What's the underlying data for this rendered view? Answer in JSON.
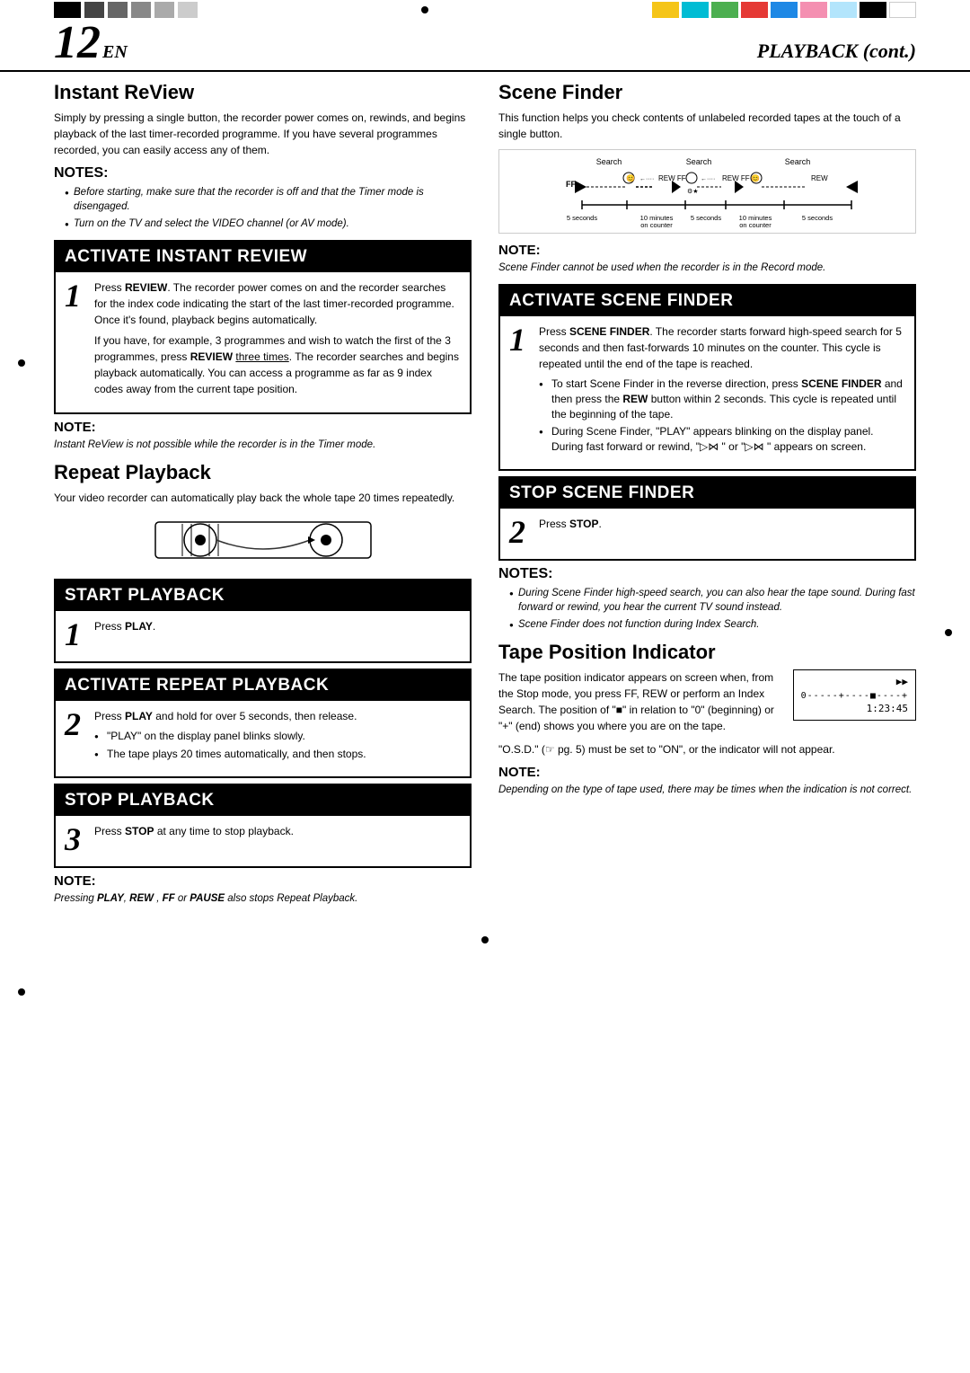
{
  "page": {
    "number": "12",
    "en": "EN",
    "title": "PLAYBACK (cont.)"
  },
  "colorbar_left": [
    {
      "color": "black",
      "label": "black-1"
    },
    {
      "color": "dark",
      "label": "dark-1"
    },
    {
      "color": "dark",
      "label": "dark-2"
    },
    {
      "color": "dark",
      "label": "dark-3"
    },
    {
      "color": "dark",
      "label": "dark-4"
    },
    {
      "color": "dark",
      "label": "dark-5"
    }
  ],
  "colorbar_right": [
    {
      "color": "yellow",
      "label": "yellow"
    },
    {
      "color": "cyan",
      "label": "cyan"
    },
    {
      "color": "green",
      "label": "green"
    },
    {
      "color": "red",
      "label": "red"
    },
    {
      "color": "blue",
      "label": "blue"
    },
    {
      "color": "pink",
      "label": "pink"
    },
    {
      "color": "lightblue",
      "label": "lightblue"
    },
    {
      "color": "black",
      "label": "black-2"
    },
    {
      "color": "white",
      "label": "white"
    }
  ],
  "instant_review": {
    "title": "Instant ReView",
    "description": "Simply by pressing a single button, the recorder power comes on, rewinds, and begins playback of the last timer-recorded programme. If you have several programmes recorded, you can easily access any of them.",
    "notes_header": "NOTES:",
    "notes": [
      "Before starting, make sure that the recorder is off and that the Timer mode is disengaged.",
      "Turn on the TV and select the VIDEO channel (or AV mode)."
    ],
    "step1_header": "ACTIVATE INSTANT REVIEW",
    "step1_body": "Press REVIEW. The recorder power comes on and the recorder searches for the index code indicating the start of the last timer-recorded programme. Once it's found, playback begins automatically.\nIf you have, for example, 3 programmes and wish to watch the first of the 3 programmes, press REVIEW three times. The recorder searches and begins playback automatically. You can access a programme as far as 9 index codes away from the current tape position.",
    "note_header": "NOTE:",
    "note_text": "Instant ReView is not possible while the recorder is in the Timer mode."
  },
  "repeat_playback": {
    "title": "Repeat Playback",
    "description": "Your video recorder can automatically play back the whole tape 20 times repeatedly.",
    "step1_header": "START PLAYBACK",
    "step1_body": "Press PLAY.",
    "step2_header": "ACTIVATE REPEAT PLAYBACK",
    "step2_body": "Press PLAY and hold for over 5 seconds, then release.",
    "step2_bullets": [
      "\"PLAY\" on the display panel blinks slowly.",
      "The tape plays 20 times automatically, and then stops."
    ],
    "step3_header": "STOP PLAYBACK",
    "step3_body": "Press STOP at any time to stop playback.",
    "note_header": "NOTE:",
    "note_text": "Pressing PLAY, REW , FF or PAUSE also stops Repeat Playback."
  },
  "scene_finder": {
    "title": "Scene Finder",
    "description": "This function helps you check contents of unlabeled recorded tapes at the touch of a single button.",
    "note_header": "NOTE:",
    "note_text": "Scene Finder cannot be used when the recorder is in the Record mode.",
    "step1_header": "ACTIVATE SCENE FINDER",
    "step1_body": "Press SCENE FINDER. The recorder starts forward high-speed search for 5 seconds and then fast-forwards 10 minutes on the counter. This cycle is repeated until the end of the tape is reached.",
    "step1_bullets": [
      "To start Scene Finder in the reverse direction, press SCENE FINDER and then press the REW button within 2 seconds. This cycle is repeated until the beginning of the tape.",
      "During Scene Finder, \"PLAY\" appears blinking on the display panel. During fast forward or rewind, \" \" or \" \" appears on screen."
    ],
    "step2_header": "STOP SCENE FINDER",
    "step2_body": "Press STOP.",
    "notes2_header": "NOTES:",
    "notes2": [
      "During Scene Finder high-speed search, you can also hear the tape sound. During fast forward or rewind, you hear the current TV sound instead.",
      "Scene Finder does not function during Index Search."
    ]
  },
  "tape_position": {
    "title": "Tape Position Indicator",
    "description": "The tape position indicator appears on screen when, from the Stop mode, you press FF, REW or perform an Index Search. The position of \"■\" in relation to \"0\" (beginning) or \"+\" (end) shows you where you are on the tape.",
    "osd_note": "\"O.S.D.\" (☞ pg. 5) must be set to \"ON\", or the indicator will not appear.",
    "note_header": "NOTE:",
    "note_text": "Depending on the type of tape used, there may be times when the indication is not correct.",
    "diagram_label": "1:23:45",
    "diagram_ff": "▶▶"
  },
  "labels": {
    "play_bold": "PLAY",
    "review_bold": "REVIEW",
    "stop_bold": "STOP",
    "ff_bold": "FF",
    "rew_bold": "REW",
    "pause_bold": "PAUSE",
    "scene_finder_bold": "SCENE FINDER",
    "three_times": "three times"
  }
}
